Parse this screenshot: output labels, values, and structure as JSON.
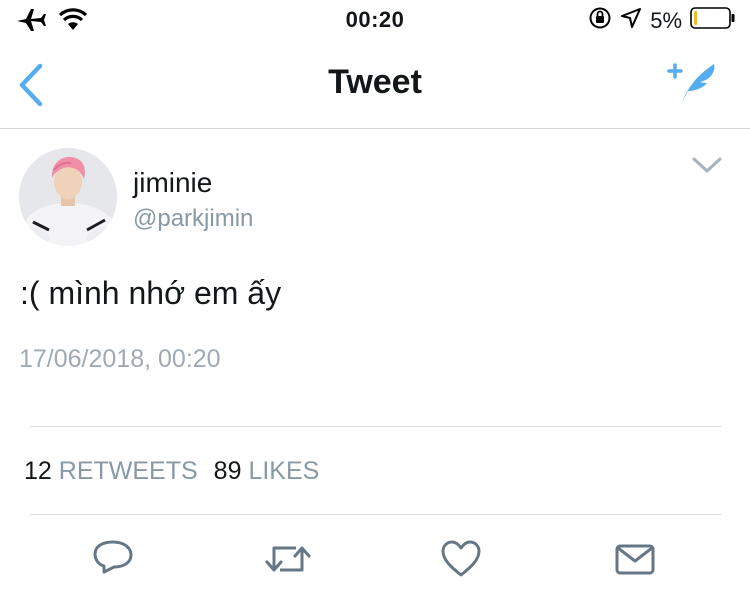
{
  "status_bar": {
    "time": "00:20",
    "battery_percent": "5%",
    "icons": [
      "airplane-icon",
      "wifi-icon",
      "orientation-lock-icon",
      "location-icon",
      "battery-icon"
    ]
  },
  "nav": {
    "title": "Tweet",
    "back_icon": "chevron-left-icon",
    "compose_icon": "compose-tweet-icon",
    "accent_color": "#55acee"
  },
  "tweet": {
    "display_name": "jiminie",
    "username": "@parkjimin",
    "text": ":( mình nhớ em ấy",
    "timestamp": "17/06/2018, 00:20",
    "retweets_count": "12",
    "retweets_label": "RETWEETS",
    "likes_count": "89",
    "likes_label": "LIKES"
  },
  "actions": [
    {
      "name": "reply",
      "icon": "reply-icon"
    },
    {
      "name": "retweet",
      "icon": "retweet-icon"
    },
    {
      "name": "like",
      "icon": "heart-icon"
    },
    {
      "name": "message",
      "icon": "mail-icon"
    }
  ],
  "colors": {
    "text": "#14171a",
    "secondary": "#8899a6",
    "icon_gray": "#657786",
    "accent": "#55acee"
  }
}
